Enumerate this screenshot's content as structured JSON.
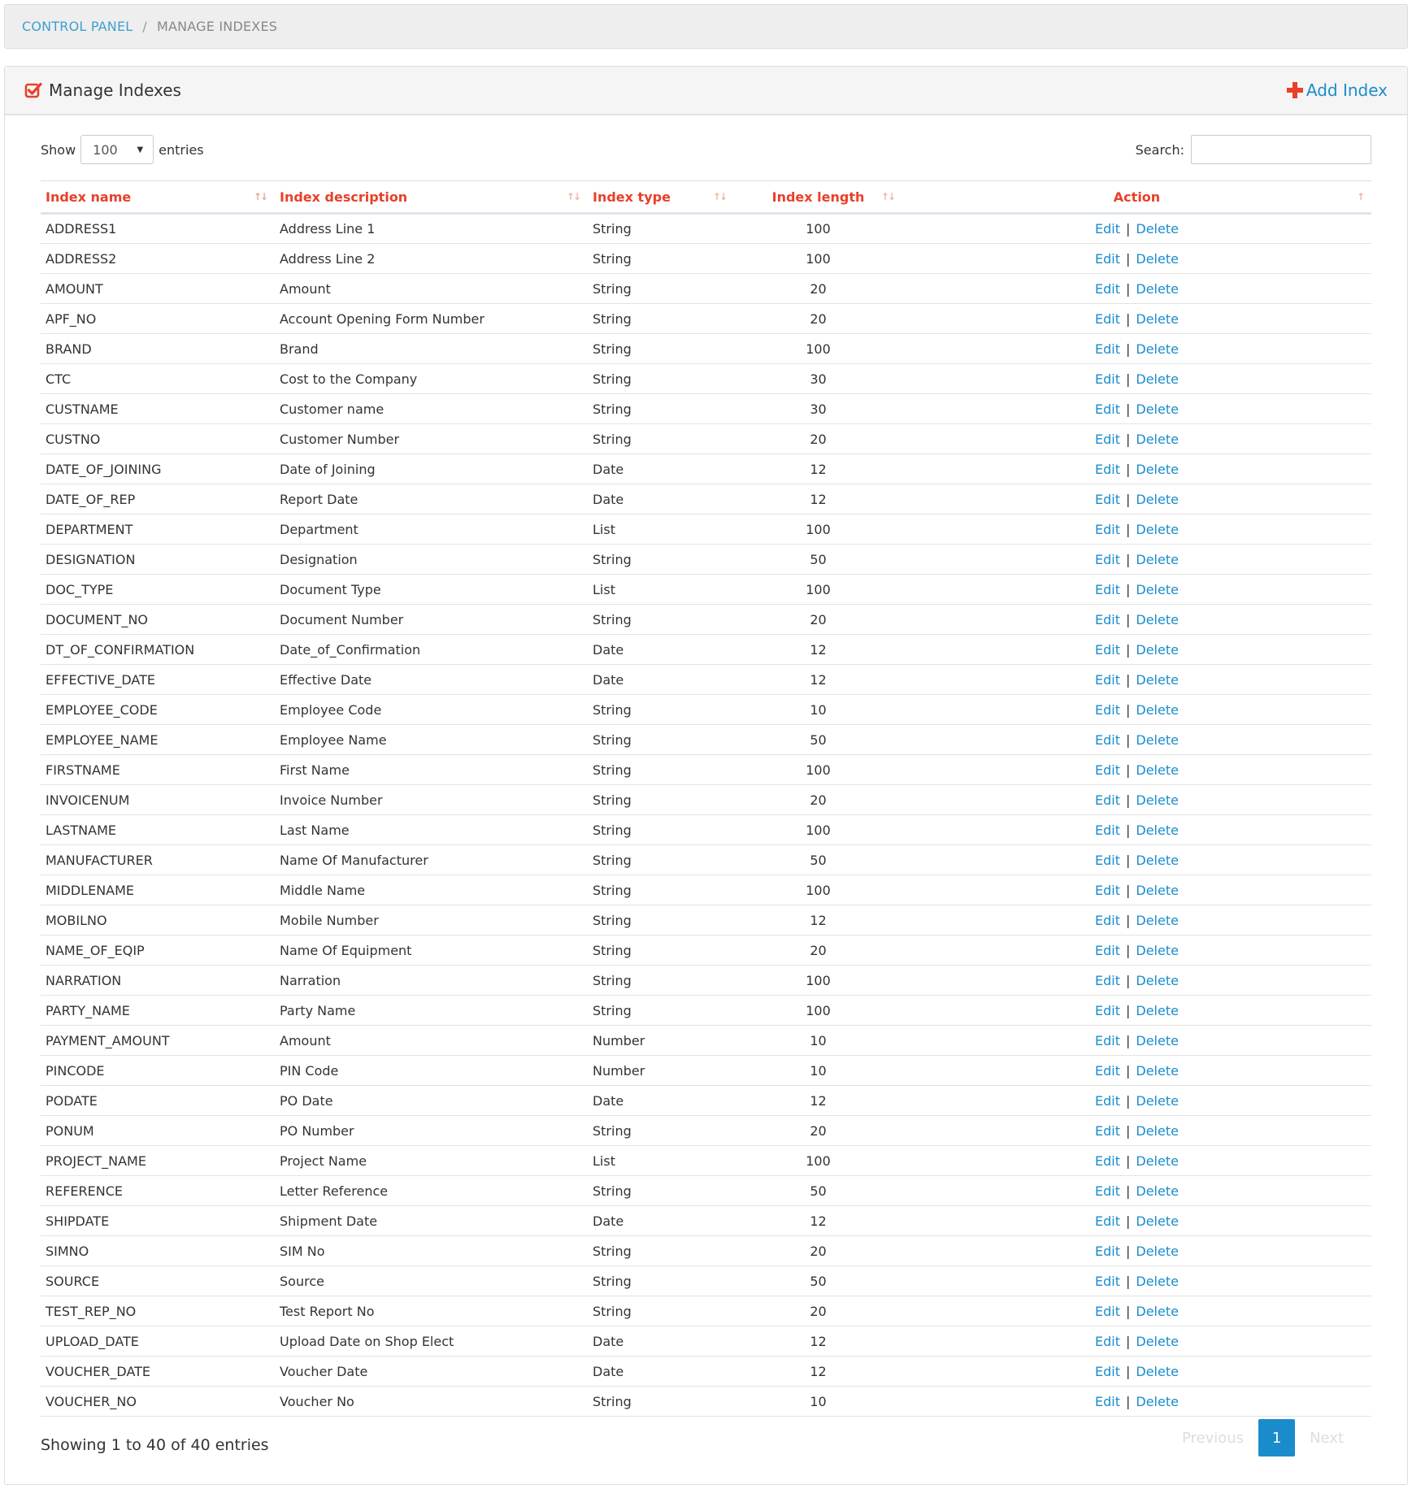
{
  "breadcrumb": {
    "link": "Control Panel",
    "separator": "/",
    "current": "Manage Indexes"
  },
  "panel": {
    "title": "Manage Indexes",
    "add_label": "Add Index",
    "icons": {
      "title": "check-square-icon",
      "add": "plus-icon"
    },
    "colors": {
      "accent": "#e8402a",
      "link": "#1a8ccc"
    }
  },
  "controls": {
    "show_label": "Show",
    "entries_label": "entries",
    "page_length": "100",
    "search_label": "Search:",
    "search_value": ""
  },
  "table": {
    "columns": [
      "Index name",
      "Index description",
      "Index type",
      "Index length",
      "Action"
    ],
    "edit_label": "Edit",
    "delete_label": "Delete",
    "rows": [
      {
        "name": "ADDRESS1",
        "description": "Address Line 1",
        "type": "String",
        "length": "100"
      },
      {
        "name": "ADDRESS2",
        "description": "Address Line 2",
        "type": "String",
        "length": "100"
      },
      {
        "name": "AMOUNT",
        "description": "Amount",
        "type": "String",
        "length": "20"
      },
      {
        "name": "APF_NO",
        "description": "Account Opening Form Number",
        "type": "String",
        "length": "20"
      },
      {
        "name": "BRAND",
        "description": "Brand",
        "type": "String",
        "length": "100"
      },
      {
        "name": "CTC",
        "description": "Cost to the Company",
        "type": "String",
        "length": "30"
      },
      {
        "name": "CUSTNAME",
        "description": "Customer name",
        "type": "String",
        "length": "30"
      },
      {
        "name": "CUSTNO",
        "description": "Customer Number",
        "type": "String",
        "length": "20"
      },
      {
        "name": "DATE_OF_JOINING",
        "description": "Date of Joining",
        "type": "Date",
        "length": "12"
      },
      {
        "name": "DATE_OF_REP",
        "description": "Report Date",
        "type": "Date",
        "length": "12"
      },
      {
        "name": "DEPARTMENT",
        "description": "Department",
        "type": "List",
        "length": "100"
      },
      {
        "name": "DESIGNATION",
        "description": "Designation",
        "type": "String",
        "length": "50"
      },
      {
        "name": "DOC_TYPE",
        "description": "Document Type",
        "type": "List",
        "length": "100"
      },
      {
        "name": "DOCUMENT_NO",
        "description": "Document Number",
        "type": "String",
        "length": "20"
      },
      {
        "name": "DT_OF_CONFIRMATION",
        "description": "Date_of_Confirmation",
        "type": "Date",
        "length": "12"
      },
      {
        "name": "EFFECTIVE_DATE",
        "description": "Effective Date",
        "type": "Date",
        "length": "12"
      },
      {
        "name": "EMPLOYEE_CODE",
        "description": "Employee Code",
        "type": "String",
        "length": "10"
      },
      {
        "name": "EMPLOYEE_NAME",
        "description": "Employee Name",
        "type": "String",
        "length": "50"
      },
      {
        "name": "FIRSTNAME",
        "description": "First Name",
        "type": "String",
        "length": "100"
      },
      {
        "name": "INVOICENUM",
        "description": "Invoice Number",
        "type": "String",
        "length": "20"
      },
      {
        "name": "LASTNAME",
        "description": "Last Name",
        "type": "String",
        "length": "100"
      },
      {
        "name": "MANUFACTURER",
        "description": "Name Of Manufacturer",
        "type": "String",
        "length": "50"
      },
      {
        "name": "MIDDLENAME",
        "description": "Middle Name",
        "type": "String",
        "length": "100"
      },
      {
        "name": "MOBILNO",
        "description": "Mobile Number",
        "type": "String",
        "length": "12"
      },
      {
        "name": "NAME_OF_EQIP",
        "description": "Name Of Equipment",
        "type": "String",
        "length": "20"
      },
      {
        "name": "NARRATION",
        "description": "Narration",
        "type": "String",
        "length": "100"
      },
      {
        "name": "PARTY_NAME",
        "description": "Party Name",
        "type": "String",
        "length": "100"
      },
      {
        "name": "PAYMENT_AMOUNT",
        "description": "Amount",
        "type": "Number",
        "length": "10"
      },
      {
        "name": "PINCODE",
        "description": "PIN Code",
        "type": "Number",
        "length": "10"
      },
      {
        "name": "PODATE",
        "description": "PO Date",
        "type": "Date",
        "length": "12"
      },
      {
        "name": "PONUM",
        "description": "PO Number",
        "type": "String",
        "length": "20"
      },
      {
        "name": "PROJECT_NAME",
        "description": "Project Name",
        "type": "List",
        "length": "100"
      },
      {
        "name": "REFERENCE",
        "description": "Letter Reference",
        "type": "String",
        "length": "50"
      },
      {
        "name": "SHIPDATE",
        "description": "Shipment Date",
        "type": "Date",
        "length": "12"
      },
      {
        "name": "SIMNO",
        "description": "SIM No",
        "type": "String",
        "length": "20"
      },
      {
        "name": "SOURCE",
        "description": "Source",
        "type": "String",
        "length": "50"
      },
      {
        "name": "TEST_REP_NO",
        "description": "Test Report No",
        "type": "String",
        "length": "20"
      },
      {
        "name": "UPLOAD_DATE",
        "description": "Upload Date on Shop Elect",
        "type": "Date",
        "length": "12"
      },
      {
        "name": "VOUCHER_DATE",
        "description": "Voucher Date",
        "type": "Date",
        "length": "12"
      },
      {
        "name": "VOUCHER_NO",
        "description": "Voucher No",
        "type": "String",
        "length": "10"
      }
    ]
  },
  "footer": {
    "info": "Showing 1 to 40 of 40 entries",
    "previous": "Previous",
    "current_page": "1",
    "next": "Next"
  }
}
